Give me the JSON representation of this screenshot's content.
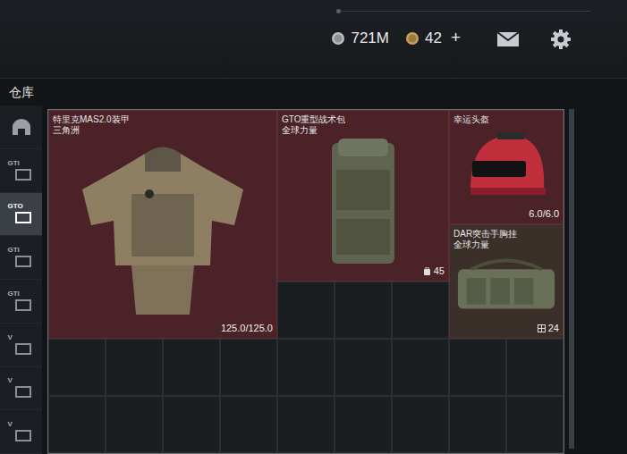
{
  "header": {
    "silver": "721M",
    "gold": "42",
    "add": "+"
  },
  "section_title": "仓库",
  "sidebar": {
    "items": [
      {
        "kind": "dome",
        "selected": false
      },
      {
        "kind": "tag",
        "label": "GTI",
        "selected": false
      },
      {
        "kind": "tag",
        "label": "GTO",
        "selected": true
      },
      {
        "kind": "tag",
        "label": "GTI",
        "selected": false
      },
      {
        "kind": "tag",
        "label": "GTI",
        "selected": false
      },
      {
        "kind": "tag",
        "label": "V",
        "selected": false
      },
      {
        "kind": "tag",
        "label": "V",
        "selected": false
      },
      {
        "kind": "tag",
        "label": "V",
        "selected": false
      }
    ]
  },
  "items": [
    {
      "kind": "armor",
      "name": "特里克MAS2.0装甲",
      "brand": "三角洲",
      "reading": "125.0/125.0"
    },
    {
      "kind": "backpack",
      "name": "GTO重型战术包",
      "brand": "全球力量",
      "reading": "45"
    },
    {
      "kind": "helmet",
      "name": "幸运头盔",
      "reading": "6.0/6.0"
    },
    {
      "kind": "rig",
      "name": "DAR突击手胸挂",
      "brand": "全球力量",
      "reading": "24"
    }
  ]
}
